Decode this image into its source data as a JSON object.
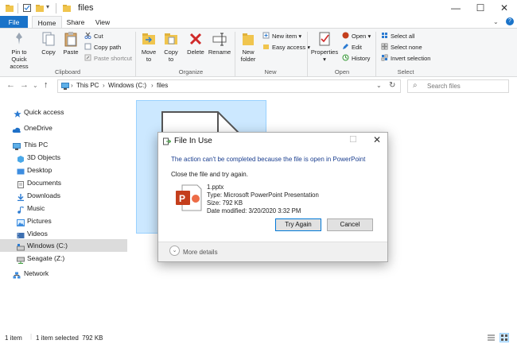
{
  "window": {
    "title": "files",
    "controls": {
      "minimize": "—",
      "maximize": "☐",
      "close": "✕"
    }
  },
  "tabs": [
    {
      "label": "File"
    },
    {
      "label": "Home"
    },
    {
      "label": "Share"
    },
    {
      "label": "View"
    }
  ],
  "ribbon": {
    "clipboard": {
      "pin": "Pin to Quick access",
      "copy": "Copy",
      "paste": "Paste",
      "cut": "Cut",
      "copy_path": "Copy path",
      "paste_shortcut": "Paste shortcut",
      "label": "Clipboard"
    },
    "organize": {
      "move_to": "Move to",
      "copy_to": "Copy to",
      "delete": "Delete",
      "rename": "Rename",
      "label": "Organize"
    },
    "new": {
      "new_folder": "New folder",
      "new_item": "New item",
      "easy_access": "Easy access",
      "label": "New"
    },
    "open": {
      "properties": "Properties",
      "open": "Open",
      "edit": "Edit",
      "history": "History",
      "label": "Open"
    },
    "select": {
      "select_all": "Select all",
      "select_none": "Select none",
      "invert": "Invert selection",
      "label": "Select"
    }
  },
  "address": {
    "crumbs": [
      "This PC",
      "Windows (C:)",
      "files"
    ],
    "search_placeholder": "Search files"
  },
  "sidebar": {
    "items": [
      {
        "label": "Quick access"
      },
      {
        "label": "OneDrive"
      },
      {
        "label": "This PC"
      },
      {
        "label": "3D Objects"
      },
      {
        "label": "Desktop"
      },
      {
        "label": "Documents"
      },
      {
        "label": "Downloads"
      },
      {
        "label": "Music"
      },
      {
        "label": "Pictures"
      },
      {
        "label": "Videos"
      },
      {
        "label": "Windows (C:)"
      },
      {
        "label": "Seagate (Z:)"
      },
      {
        "label": "Network"
      }
    ]
  },
  "status": {
    "count": "1 item",
    "selected": "1 item selected  792 KB"
  },
  "dialog": {
    "title": "File In Use",
    "message": "The action can't be completed because the file is open in PowerPoint",
    "instruction": "Close the file and try again.",
    "file_name": "1.pptx",
    "file_type": "Type: Microsoft PowerPoint Presentation",
    "file_size": "Size: 792 KB",
    "file_modified": "Date modified: 3/20/2020 3:32 PM",
    "try_again": "Try Again",
    "cancel": "Cancel",
    "more_details": "More details",
    "minimize": "☐",
    "close": "✕"
  },
  "colors": {
    "accent": "#1a73c9",
    "powerpoint": "#c43e1c",
    "selection": "#cce8ff",
    "link_text": "#1a3e8f"
  }
}
